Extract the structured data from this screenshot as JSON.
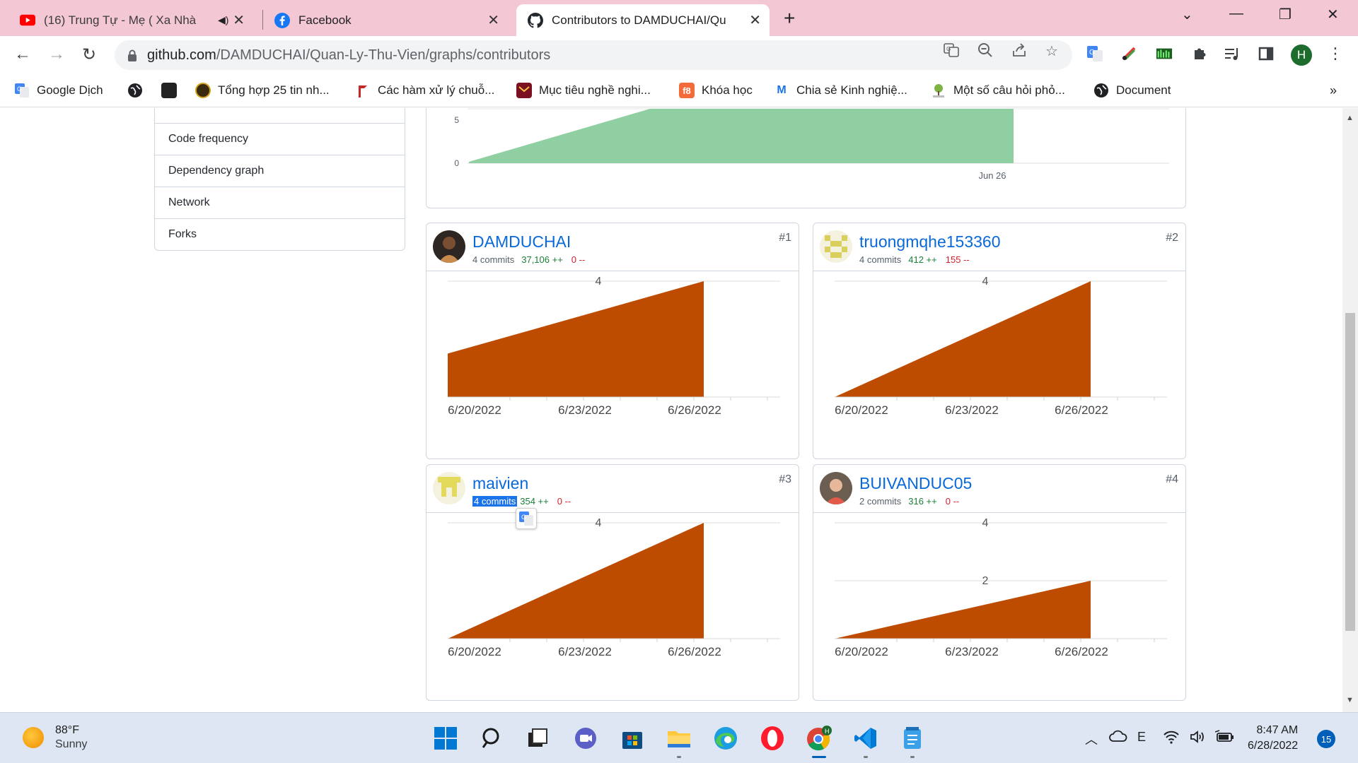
{
  "browser": {
    "tabs": [
      {
        "title": "(16) Trung Tự - Mẹ ( Xa Nhà",
        "icon": "youtube-icon"
      },
      {
        "title": "Facebook",
        "icon": "facebook-icon"
      },
      {
        "title": "Contributors to DAMDUCHAI/Qu",
        "icon": "github-icon"
      }
    ],
    "url_host": "github.com",
    "url_path": "/DAMDUCHAI/Quan-Ly-Thu-Vien/graphs/contributors",
    "profile_initial": "H",
    "bookmarks": [
      {
        "label": "Google Dịch",
        "icon": "google-translate-icon"
      },
      {
        "label": "",
        "icon": "globe-icon"
      },
      {
        "label": "",
        "icon": "dark-thumbnail-icon"
      },
      {
        "label": "Tổng hợp 25 tin nh...",
        "icon": "round-logo-icon"
      },
      {
        "label": "Các hàm xử lý chuỗ...",
        "icon": "red-flag-icon"
      },
      {
        "label": "Mục tiêu nghề nghi...",
        "icon": "envelope-logo-icon"
      },
      {
        "label": "Khóa học",
        "icon": "f8-icon"
      },
      {
        "label": "Chia sẻ Kinh nghiệ...",
        "icon": "m-logo-icon"
      },
      {
        "label": "Một số câu hỏi phỏ...",
        "icon": "tree-icon"
      },
      {
        "label": "Document",
        "icon": "globe-icon"
      }
    ],
    "bookmarks_overflow": "»"
  },
  "sidebar": {
    "items": [
      "Code frequency",
      "Dependency graph",
      "Network",
      "Forks"
    ]
  },
  "main_chart": {
    "y_ticks": [
      "5",
      "0"
    ],
    "x_label": "Jun 26",
    "color": "#8fcfa1"
  },
  "chart_data": [
    {
      "type": "area",
      "title": "DAMDUCHAI",
      "x": [
        "6/20/2022",
        "6/26/2022"
      ],
      "y": [
        1.5,
        4
      ],
      "y_gridlines": [
        4
      ],
      "xticks": [
        "6/20/2022",
        "6/23/2022",
        "6/26/2022"
      ],
      "ylim": [
        0,
        4
      ]
    },
    {
      "type": "area",
      "title": "truongmqhe153360",
      "x": [
        "6/20/2022",
        "6/26/2022"
      ],
      "y": [
        0,
        4
      ],
      "y_gridlines": [
        4
      ],
      "xticks": [
        "6/20/2022",
        "6/23/2022",
        "6/26/2022"
      ],
      "ylim": [
        0,
        4
      ]
    },
    {
      "type": "area",
      "title": "maivien",
      "x": [
        "6/20/2022",
        "6/26/2022"
      ],
      "y": [
        0,
        4
      ],
      "y_gridlines": [
        4
      ],
      "xticks": [
        "6/20/2022",
        "6/23/2022",
        "6/26/2022"
      ],
      "ylim": [
        0,
        4
      ]
    },
    {
      "type": "area",
      "title": "BUIVANDUC05",
      "x": [
        "6/20/2022",
        "6/26/2022"
      ],
      "y": [
        0,
        2
      ],
      "y_gridlines": [
        4,
        2
      ],
      "xticks": [
        "6/20/2022",
        "6/23/2022",
        "6/26/2022"
      ],
      "ylim": [
        0,
        4
      ]
    }
  ],
  "contributors": [
    {
      "name": "DAMDUCHAI",
      "commits": "4 commits",
      "additions": "37,106 ++",
      "deletions": "0 --",
      "rank": "#1",
      "avatar": "dark-photo-avatar"
    },
    {
      "name": "truongmqhe153360",
      "commits": "4 commits",
      "additions": "412 ++",
      "deletions": "155 --",
      "rank": "#2",
      "avatar": "yellow-identicon-avatar"
    },
    {
      "name": "maivien",
      "commits": "4 commits",
      "additions": "354 ++",
      "deletions": "0 --",
      "rank": "#3",
      "avatar": "yellow-identicon-avatar"
    },
    {
      "name": "BUIVANDUC05",
      "commits": "2 commits",
      "additions": "316 ++",
      "deletions": "0 --",
      "rank": "#4",
      "avatar": "photo-avatar"
    }
  ],
  "colors": {
    "area_fill": "#bd4b00",
    "link": "#0969da",
    "additions": "#1a7f37",
    "deletions": "#cf222e"
  },
  "taskbar": {
    "temperature": "88°F",
    "condition": "Sunny",
    "time": "8:47 AM",
    "date": "6/28/2022",
    "notifications": "15"
  }
}
